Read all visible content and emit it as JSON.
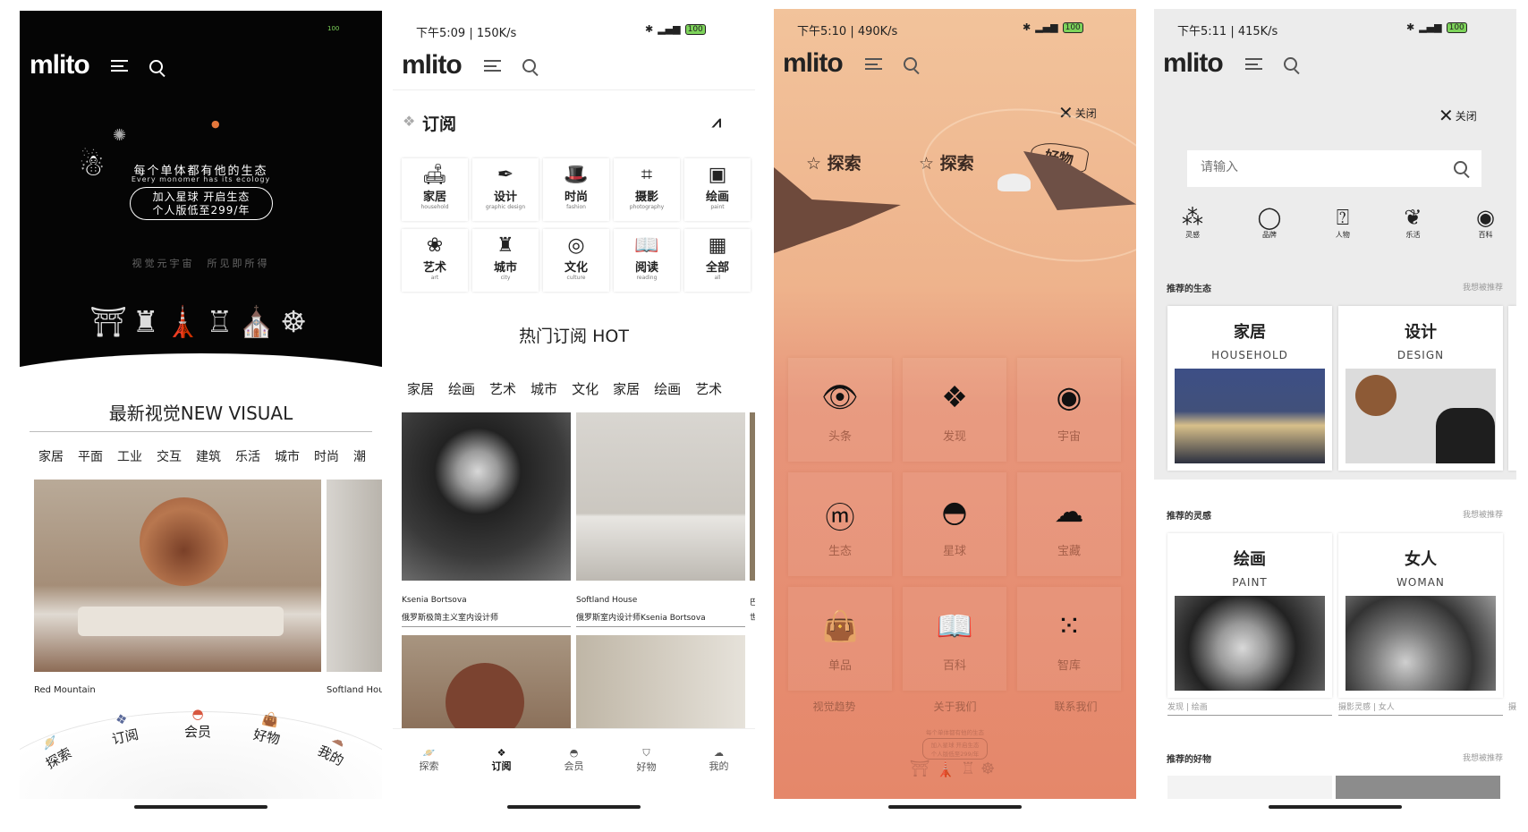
{
  "screens": [
    {
      "brand": "mlito",
      "battery": "100",
      "hero": {
        "line1": "每个单体都有他的生态",
        "line2": "Every monomer has its ecology",
        "button_line1": "加入星球  开启生态",
        "button_line2": "个人版低至299/年",
        "tagline": "视觉元宇宙　所见即所得"
      },
      "section_title": "最新视觉NEW VISUAL",
      "categories": [
        "家居",
        "平面",
        "工业",
        "交互",
        "建筑",
        "乐活",
        "城市",
        "时尚",
        "潮"
      ],
      "captions": [
        "Red Mountain",
        "Softland Hou:"
      ],
      "nav": [
        "探索",
        "订阅",
        "会员",
        "好物",
        "我的"
      ]
    },
    {
      "status_time": "下午5:09 | 150K/s",
      "battery": "100",
      "brand": "mlito",
      "title": "订阅",
      "grid": [
        {
          "label": "家居",
          "sub": "household",
          "icon": "sofa-icon"
        },
        {
          "label": "设计",
          "sub": "graphic design",
          "icon": "pen-icon"
        },
        {
          "label": "时尚",
          "sub": "fashion",
          "icon": "hat-icon"
        },
        {
          "label": "摄影",
          "sub": "photography",
          "icon": "camera-icon"
        },
        {
          "label": "绘画",
          "sub": "paint",
          "icon": "painting-icon"
        },
        {
          "label": "艺术",
          "sub": "art",
          "icon": "art-icon"
        },
        {
          "label": "城市",
          "sub": "city",
          "icon": "city-icon"
        },
        {
          "label": "文化",
          "sub": "culture",
          "icon": "culture-icon"
        },
        {
          "label": "阅读",
          "sub": "reading",
          "icon": "book-icon"
        },
        {
          "label": "全部",
          "sub": "all",
          "icon": "grid-icon"
        }
      ],
      "hot_title": "热门订阅 HOT",
      "tabs": [
        "家居",
        "绘画",
        "艺术",
        "城市",
        "文化",
        "家居",
        "绘画",
        "艺术"
      ],
      "posts": [
        {
          "name": "Ksenia Bortsova",
          "desc": "俄罗斯极简主义室内设计师"
        },
        {
          "name": "Softland House",
          "desc": "俄罗斯室内设计师Ksenia Bortsova"
        },
        {
          "name": "巴",
          "desc": "世"
        }
      ],
      "nav": [
        "探索",
        "订阅",
        "会员",
        "好物",
        "我的"
      ],
      "nav_active": "订阅"
    },
    {
      "status_time": "下午5:10 | 490K/s",
      "battery": "100",
      "brand": "mlito",
      "close": "关闭",
      "top_links": [
        "探索",
        "探索",
        "好物"
      ],
      "grid": [
        {
          "label": "头条",
          "icon": "eye-icon"
        },
        {
          "label": "发现",
          "icon": "dropbox-icon"
        },
        {
          "label": "宇宙",
          "icon": "orbit-icon"
        },
        {
          "label": "生态",
          "icon": "m-badge-icon"
        },
        {
          "label": "星球",
          "icon": "planet-icon"
        },
        {
          "label": "宝藏",
          "icon": "cloud-icon"
        },
        {
          "label": "单品",
          "icon": "bag-icon"
        },
        {
          "label": "百科",
          "icon": "book-icon"
        },
        {
          "label": "智库",
          "icon": "dots-icon"
        }
      ],
      "footer_links": [
        "视觉趋势",
        "关于我们",
        "联系我们"
      ],
      "footer_art": {
        "line1": "每个单体都有他的生态",
        "line2": "加入星球 开启生态",
        "line3": "个人版低至299/年"
      },
      "colors": {
        "top": "#f2c39b",
        "bottom": "#e5876a"
      }
    },
    {
      "status_time": "下午5:11 | 415K/s",
      "battery": "100",
      "brand": "mlito",
      "close": "关闭",
      "search_placeholder": "请输入",
      "quick": [
        "灵感",
        "品牌",
        "人物",
        "乐活",
        "百科"
      ],
      "sections": [
        {
          "title": "推荐的生态",
          "action": "我想被推荐",
          "cards": [
            {
              "t": "家居",
              "e": "HOUSEHOLD"
            },
            {
              "t": "设计",
              "e": "DESIGN"
            }
          ]
        },
        {
          "title": "推荐的灵感",
          "action": "我想被推荐",
          "cards": [
            {
              "t": "绘画",
              "e": "PAINT",
              "cap": "发现 | 绘画"
            },
            {
              "t": "女人",
              "e": "WOMAN",
              "cap": "摄影灵感 | 女人"
            }
          ],
          "extra_cap": "摄"
        },
        {
          "title": "推荐的好物",
          "action": "我想被推荐"
        }
      ]
    }
  ]
}
